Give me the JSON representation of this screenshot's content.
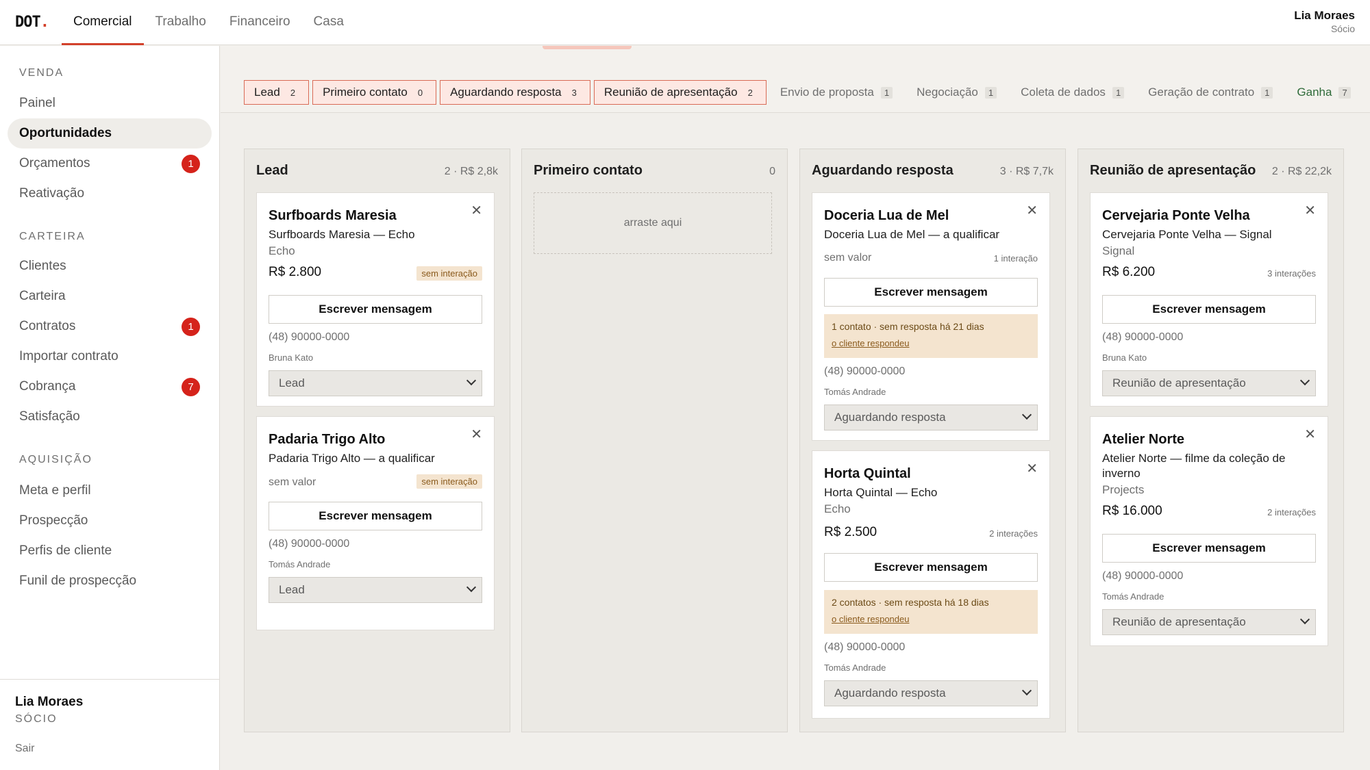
{
  "app": {
    "logo": "DOT",
    "logo_dot": ".",
    "nav": [
      "Comercial",
      "Trabalho",
      "Financeiro",
      "Casa"
    ],
    "active_nav": "Comercial",
    "user": {
      "name": "Lia Moraes",
      "role": "Sócio"
    }
  },
  "sidebar": {
    "sections": [
      {
        "title": "VENDA",
        "items": [
          {
            "label": "Painel",
            "badge": null
          },
          {
            "label": "Oportunidades",
            "badge": null,
            "active": true
          },
          {
            "label": "Orçamentos",
            "badge": "1"
          },
          {
            "label": "Reativação",
            "badge": null
          }
        ]
      },
      {
        "title": "CARTEIRA",
        "items": [
          {
            "label": "Clientes",
            "badge": null
          },
          {
            "label": "Carteira",
            "badge": null
          },
          {
            "label": "Contratos",
            "badge": "1"
          },
          {
            "label": "Importar contrato",
            "badge": null
          },
          {
            "label": "Cobrança",
            "badge": "7"
          },
          {
            "label": "Satisfação",
            "badge": null
          }
        ]
      },
      {
        "title": "AQUISIÇÃO",
        "items": [
          {
            "label": "Meta e perfil",
            "badge": null
          },
          {
            "label": "Prospecção",
            "badge": null
          },
          {
            "label": "Perfis de cliente",
            "badge": null
          },
          {
            "label": "Funil de prospecção",
            "badge": null
          }
        ]
      }
    ],
    "footer": {
      "name": "Lia Moraes",
      "role": "SÓCIO",
      "logout": "Sair"
    }
  },
  "stages": [
    {
      "label": "Lead",
      "count": "2",
      "selected": true
    },
    {
      "label": "Primeiro contato",
      "count": "0",
      "selected": true
    },
    {
      "label": "Aguardando resposta",
      "count": "3",
      "selected": true
    },
    {
      "label": "Reunião de apresentação",
      "count": "2",
      "selected": true
    },
    {
      "label": "Envio de proposta",
      "count": "1",
      "selected": false
    },
    {
      "label": "Negociação",
      "count": "1",
      "selected": false
    },
    {
      "label": "Coleta de dados",
      "count": "1",
      "selected": false
    },
    {
      "label": "Geração de contrato",
      "count": "1",
      "selected": false
    },
    {
      "label": "Ganha",
      "count": "7",
      "selected": false,
      "won": true
    }
  ],
  "columns": [
    {
      "title": "Lead",
      "meta": "2 · R$ 2,8k",
      "cards": [
        {
          "name": "Surfboards Maresia",
          "subtitle": "Surfboards Maresia — Echo",
          "source": "Echo",
          "value": "R$ 2.800",
          "chip": "sem interação",
          "interactions": null,
          "button": "Escrever mensagem",
          "phone": "(48) 90000-0000",
          "owner": "Bruna Kato",
          "stage": "Lead",
          "alert": null
        },
        {
          "name": "Padaria Trigo Alto",
          "subtitle": "Padaria Trigo Alto — a qualificar",
          "source": null,
          "value": "sem valor",
          "chip": "sem interação",
          "interactions": null,
          "button": "Escrever mensagem",
          "phone": "(48) 90000-0000",
          "owner": "Tomás Andrade",
          "stage": "Lead",
          "alert": null
        }
      ]
    },
    {
      "title": "Primeiro contato",
      "meta": "0",
      "empty": "arraste aqui",
      "cards": []
    },
    {
      "title": "Aguardando resposta",
      "meta": "3 · R$ 7,7k",
      "cards": [
        {
          "name": "Doceria Lua de Mel",
          "subtitle": "Doceria Lua de Mel — a qualificar",
          "source": null,
          "value": "sem valor",
          "chip": null,
          "interactions": "1 interação",
          "button": "Escrever mensagem",
          "alert": {
            "text": "1 contato · sem resposta há 21 dias",
            "link": "o cliente respondeu"
          },
          "phone": "(48) 90000-0000",
          "owner": "Tomás Andrade",
          "stage": "Aguardando resposta"
        },
        {
          "name": "Horta Quintal",
          "subtitle": "Horta Quintal — Echo",
          "source": "Echo",
          "value": "R$ 2.500",
          "chip": null,
          "interactions": "2 interações",
          "button": "Escrever mensagem",
          "alert": {
            "text": "2 contatos · sem resposta há 18 dias",
            "link": "o cliente respondeu"
          },
          "phone": "(48) 90000-0000",
          "owner": "Tomás Andrade",
          "stage": "Aguardando resposta"
        }
      ]
    },
    {
      "title": "Reunião de apresentação",
      "meta": "2 · R$ 22,2k",
      "cards": [
        {
          "name": "Cervejaria Ponte Velha",
          "subtitle": "Cervejaria Ponte Velha — Signal",
          "source": "Signal",
          "value": "R$ 6.200",
          "chip": null,
          "interactions": "3 interações",
          "button": "Escrever mensagem",
          "phone": "(48) 90000-0000",
          "owner": "Bruna Kato",
          "stage": "Reunião de apresentação",
          "alert": null
        },
        {
          "name": "Atelier Norte",
          "subtitle": "Atelier Norte — filme da coleção de inverno",
          "source": "Projects",
          "value": "R$ 16.000",
          "chip": null,
          "interactions": "2 interações",
          "button": "Escrever mensagem",
          "phone": "(48) 90000-0000",
          "owner": "Tomás Andrade",
          "stage": "Reunião de apresentação",
          "alert": null
        }
      ]
    }
  ]
}
